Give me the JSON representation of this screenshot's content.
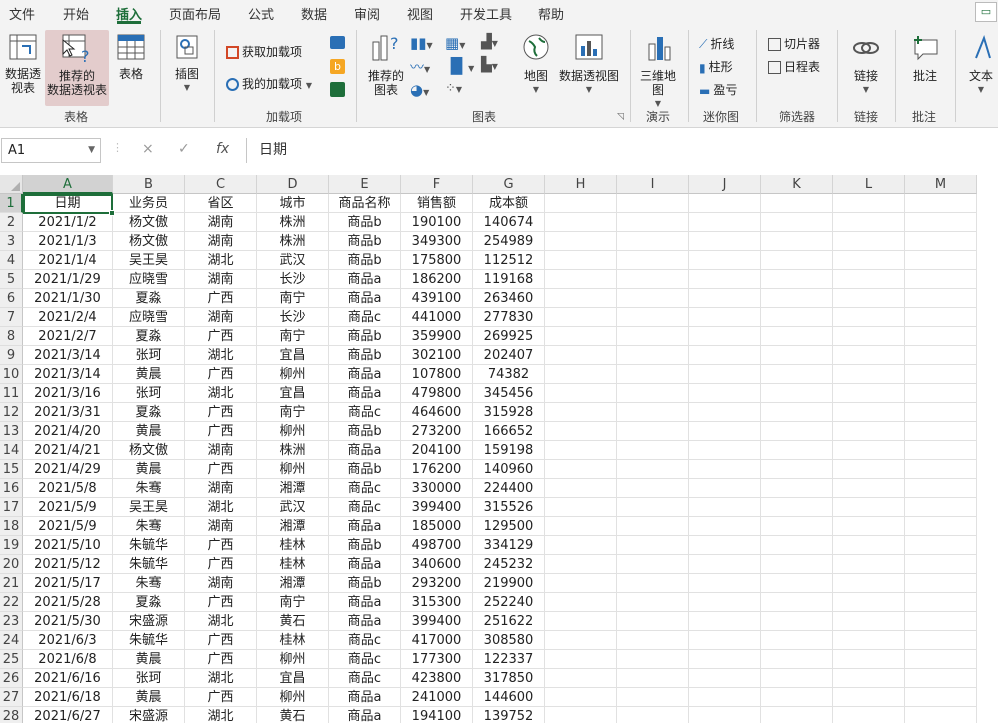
{
  "menu": {
    "tabs": [
      "文件",
      "开始",
      "插入",
      "页面布局",
      "公式",
      "数据",
      "审阅",
      "视图",
      "开发工具",
      "帮助"
    ],
    "active": "插入"
  },
  "ribbon": {
    "tables": {
      "pivot_table": "数据透\n视表",
      "recommended_pivot": "推荐的\n数据透视表",
      "table": "表格",
      "group": "表格"
    },
    "illustrations": {
      "label": "插图"
    },
    "addins": {
      "get_addins": "获取加载项",
      "my_addins": "我的加载项",
      "group": "加载项"
    },
    "charts": {
      "recommended": "推荐的\n图表",
      "map": "地图",
      "pivot_chart": "数据透视图",
      "group": "图表"
    },
    "tours": {
      "map3d": "三维地\n图",
      "group": "演示"
    },
    "sparklines": {
      "line": "折线",
      "column": "柱形",
      "winloss": "盈亏",
      "group": "迷你图"
    },
    "filters": {
      "slicer": "切片器",
      "timeline": "日程表",
      "group": "筛选器"
    },
    "links": {
      "link": "链接",
      "group": "链接"
    },
    "comments": {
      "comment": "批注",
      "group": "批注"
    },
    "text": {
      "text": "文本"
    }
  },
  "formula_bar": {
    "name_box": "A1",
    "cancel_icon": "×",
    "enter_icon": "✓",
    "fx_label": "fx",
    "formula": "日期"
  },
  "sheet": {
    "columns": [
      "A",
      "B",
      "C",
      "D",
      "E",
      "F",
      "G",
      "H",
      "I",
      "J",
      "K",
      "L",
      "M"
    ],
    "header": [
      "日期",
      "业务员",
      "省区",
      "城市",
      "商品名称",
      "销售额",
      "成本额"
    ],
    "rows": [
      [
        "2021/1/2",
        "杨文傲",
        "湖南",
        "株洲",
        "商品b",
        "190100",
        "140674"
      ],
      [
        "2021/1/3",
        "杨文傲",
        "湖南",
        "株洲",
        "商品b",
        "349300",
        "254989"
      ],
      [
        "2021/1/4",
        "吴王昊",
        "湖北",
        "武汉",
        "商品b",
        "175800",
        "112512"
      ],
      [
        "2021/1/29",
        "应晓雪",
        "湖南",
        "长沙",
        "商品a",
        "186200",
        "119168"
      ],
      [
        "2021/1/30",
        "夏淼",
        "广西",
        "南宁",
        "商品a",
        "439100",
        "263460"
      ],
      [
        "2021/2/4",
        "应晓雪",
        "湖南",
        "长沙",
        "商品c",
        "441000",
        "277830"
      ],
      [
        "2021/2/7",
        "夏淼",
        "广西",
        "南宁",
        "商品b",
        "359900",
        "269925"
      ],
      [
        "2021/3/14",
        "张珂",
        "湖北",
        "宜昌",
        "商品b",
        "302100",
        "202407"
      ],
      [
        "2021/3/14",
        "黄晨",
        "广西",
        "柳州",
        "商品a",
        "107800",
        "74382"
      ],
      [
        "2021/3/16",
        "张珂",
        "湖北",
        "宜昌",
        "商品a",
        "479800",
        "345456"
      ],
      [
        "2021/3/31",
        "夏淼",
        "广西",
        "南宁",
        "商品c",
        "464600",
        "315928"
      ],
      [
        "2021/4/20",
        "黄晨",
        "广西",
        "柳州",
        "商品b",
        "273200",
        "166652"
      ],
      [
        "2021/4/21",
        "杨文傲",
        "湖南",
        "株洲",
        "商品a",
        "204100",
        "159198"
      ],
      [
        "2021/4/29",
        "黄晨",
        "广西",
        "柳州",
        "商品b",
        "176200",
        "140960"
      ],
      [
        "2021/5/8",
        "朱骞",
        "湖南",
        "湘潭",
        "商品c",
        "330000",
        "224400"
      ],
      [
        "2021/5/9",
        "吴王昊",
        "湖北",
        "武汉",
        "商品c",
        "399400",
        "315526"
      ],
      [
        "2021/5/9",
        "朱骞",
        "湖南",
        "湘潭",
        "商品a",
        "185000",
        "129500"
      ],
      [
        "2021/5/10",
        "朱毓华",
        "广西",
        "桂林",
        "商品b",
        "498700",
        "334129"
      ],
      [
        "2021/5/12",
        "朱毓华",
        "广西",
        "桂林",
        "商品a",
        "340600",
        "245232"
      ],
      [
        "2021/5/17",
        "朱骞",
        "湖南",
        "湘潭",
        "商品b",
        "293200",
        "219900"
      ],
      [
        "2021/5/28",
        "夏淼",
        "广西",
        "南宁",
        "商品a",
        "315300",
        "252240"
      ],
      [
        "2021/5/30",
        "宋盛源",
        "湖北",
        "黄石",
        "商品a",
        "399400",
        "251622"
      ],
      [
        "2021/6/3",
        "朱毓华",
        "广西",
        "桂林",
        "商品c",
        "417000",
        "308580"
      ],
      [
        "2021/6/8",
        "黄晨",
        "广西",
        "柳州",
        "商品c",
        "177300",
        "122337"
      ],
      [
        "2021/6/16",
        "张珂",
        "湖北",
        "宜昌",
        "商品c",
        "423800",
        "317850"
      ],
      [
        "2021/6/18",
        "黄晨",
        "广西",
        "柳州",
        "商品a",
        "241000",
        "144600"
      ],
      [
        "2021/6/27",
        "宋盛源",
        "湖北",
        "黄石",
        "商品a",
        "194100",
        "139752"
      ]
    ]
  },
  "colors": {
    "accent": "#1e6e3a",
    "highlight": "#e3cccc"
  }
}
